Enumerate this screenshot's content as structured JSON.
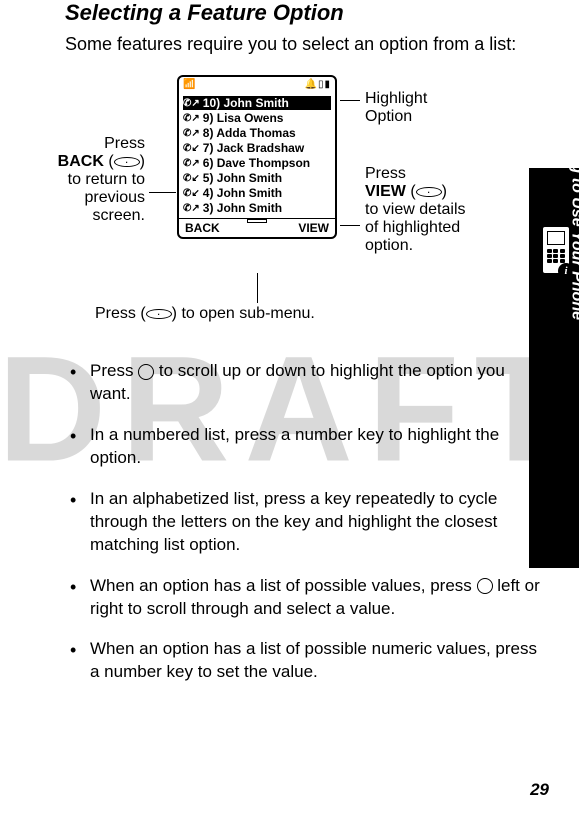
{
  "section_title": "Selecting a Feature Option",
  "intro": "Some features require you to select an option from a list:",
  "phone": {
    "list_items": [
      {
        "icon": "↗",
        "text": "10) John Smith",
        "highlighted": true
      },
      {
        "icon": "↗",
        "text": "9) Lisa Owens",
        "highlighted": false
      },
      {
        "icon": "↗",
        "text": "8) Adda Thomas",
        "highlighted": false
      },
      {
        "icon": "↙",
        "text": "7) Jack Bradshaw",
        "highlighted": false
      },
      {
        "icon": "↗",
        "text": "6) Dave Thompson",
        "highlighted": false
      },
      {
        "icon": "↙",
        "text": "5) John Smith",
        "highlighted": false
      },
      {
        "icon": "↙",
        "text": "4) John Smith",
        "highlighted": false
      },
      {
        "icon": "↗",
        "text": "3) John Smith",
        "highlighted": false
      }
    ],
    "softkey_left": "BACK",
    "softkey_right": "VIEW"
  },
  "callouts": {
    "highlight_line1": "Highlight",
    "highlight_line2": "Option",
    "left_press": "Press",
    "left_back": "BACK",
    "left_text1": "to return to",
    "left_text2": "previous",
    "left_text3": "screen.",
    "right_press": "Press",
    "right_view": "VIEW",
    "right_text1": "to view details",
    "right_text2": "of highlighted",
    "right_text3": "option.",
    "bottom_press_pre": "Press (",
    "bottom_press_post": ") to open sub-menu."
  },
  "bullets": {
    "b1_pre": "Press ",
    "b1_post": " to scroll up or down to highlight the option you want.",
    "b2": "In a numbered list, press a number key to highlight the option.",
    "b3": "In an alphabetized list, press a key repeatedly to cycle through the letters on the key and highlight the closest matching list option.",
    "b4_pre": "When an option has a list of possible values, press ",
    "b4_post": " left or right to scroll through and select a value.",
    "b5": "When an option has a list of possible numeric values, press a number key to set the value."
  },
  "side_label": "Learning to Use Your Phone",
  "info_badge": "i",
  "page_number": "29"
}
